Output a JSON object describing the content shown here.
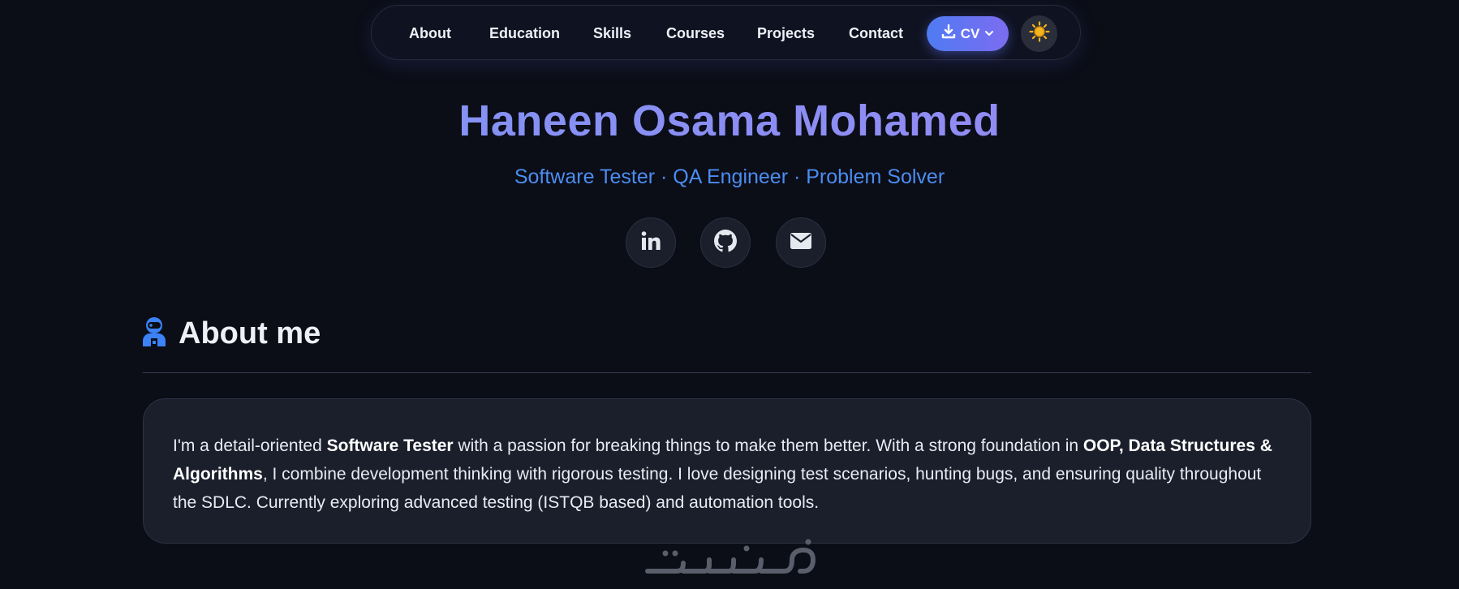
{
  "nav": {
    "items": [
      "About",
      "Education",
      "Skills",
      "Courses",
      "Projects",
      "Contact"
    ],
    "cv_label": "CV"
  },
  "hero": {
    "name": "Haneen Osama Mohamed",
    "subtitle": "Software Tester · QA Engineer · Problem Solver"
  },
  "social": [
    "linkedin-icon",
    "github-icon",
    "envelope-icon"
  ],
  "about": {
    "title": "About me",
    "p1": "I'm a detail-oriented ",
    "b1": "Software Tester",
    "p2": " with a passion for breaking things to make them better. With a strong foundation in ",
    "b2": "OOP, Data Structures & Algorithms",
    "p3": ", I combine development thinking with rigorous testing. I love designing test scenarios, hunting bugs, and ensuring quality throughout the SDLC. Currently exploring advanced testing (ISTQB based) and automation tools."
  },
  "colors": {
    "background": "#0b0d17",
    "accent": "#4f7bf3",
    "name_gradient": [
      "#7b97f5",
      "#9a86f2"
    ],
    "subtitle": "#4c8df0",
    "sun": "#f5b51f"
  }
}
